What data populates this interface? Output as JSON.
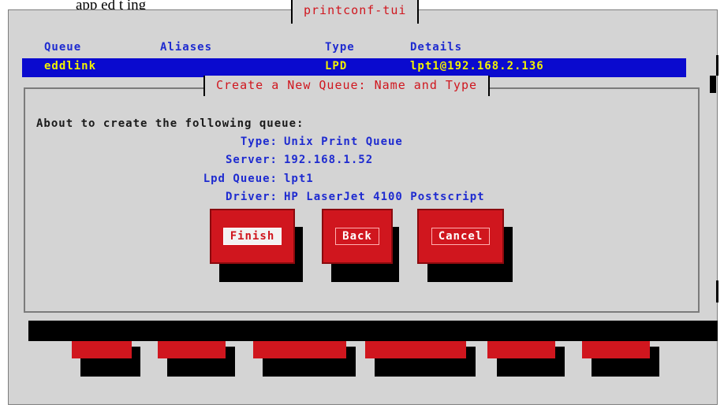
{
  "top_caption": "app      ed t        ing",
  "window": {
    "title": "printconf-tui"
  },
  "columns": {
    "queue": "Queue",
    "aliases": "Aliases",
    "type": "Type",
    "details": "Details"
  },
  "selected_row": {
    "queue": "eddlink",
    "type": "LPD",
    "details": "lpt1@192.168.2.136"
  },
  "dialog": {
    "title": "Create a New Queue: Name and Type",
    "intro": "About to create the following queue:",
    "fields": [
      {
        "label": "Type:",
        "value": "Unix Print Queue"
      },
      {
        "label": "Server:",
        "value": "192.168.1.52"
      },
      {
        "label": "Lpd Queue:",
        "value": "lpt1"
      },
      {
        "label": "Driver:",
        "value": "HP LaserJet 4100 Postscript"
      }
    ],
    "buttons": {
      "finish": "Finish",
      "back": "Back",
      "cancel": "Cancel"
    }
  },
  "colors": {
    "accent_red": "#d0161e",
    "selection_blue": "#0a0acf",
    "label_blue": "#1e2bd0",
    "selection_text": "#f2f200",
    "window_bg": "#d4d4d4"
  }
}
